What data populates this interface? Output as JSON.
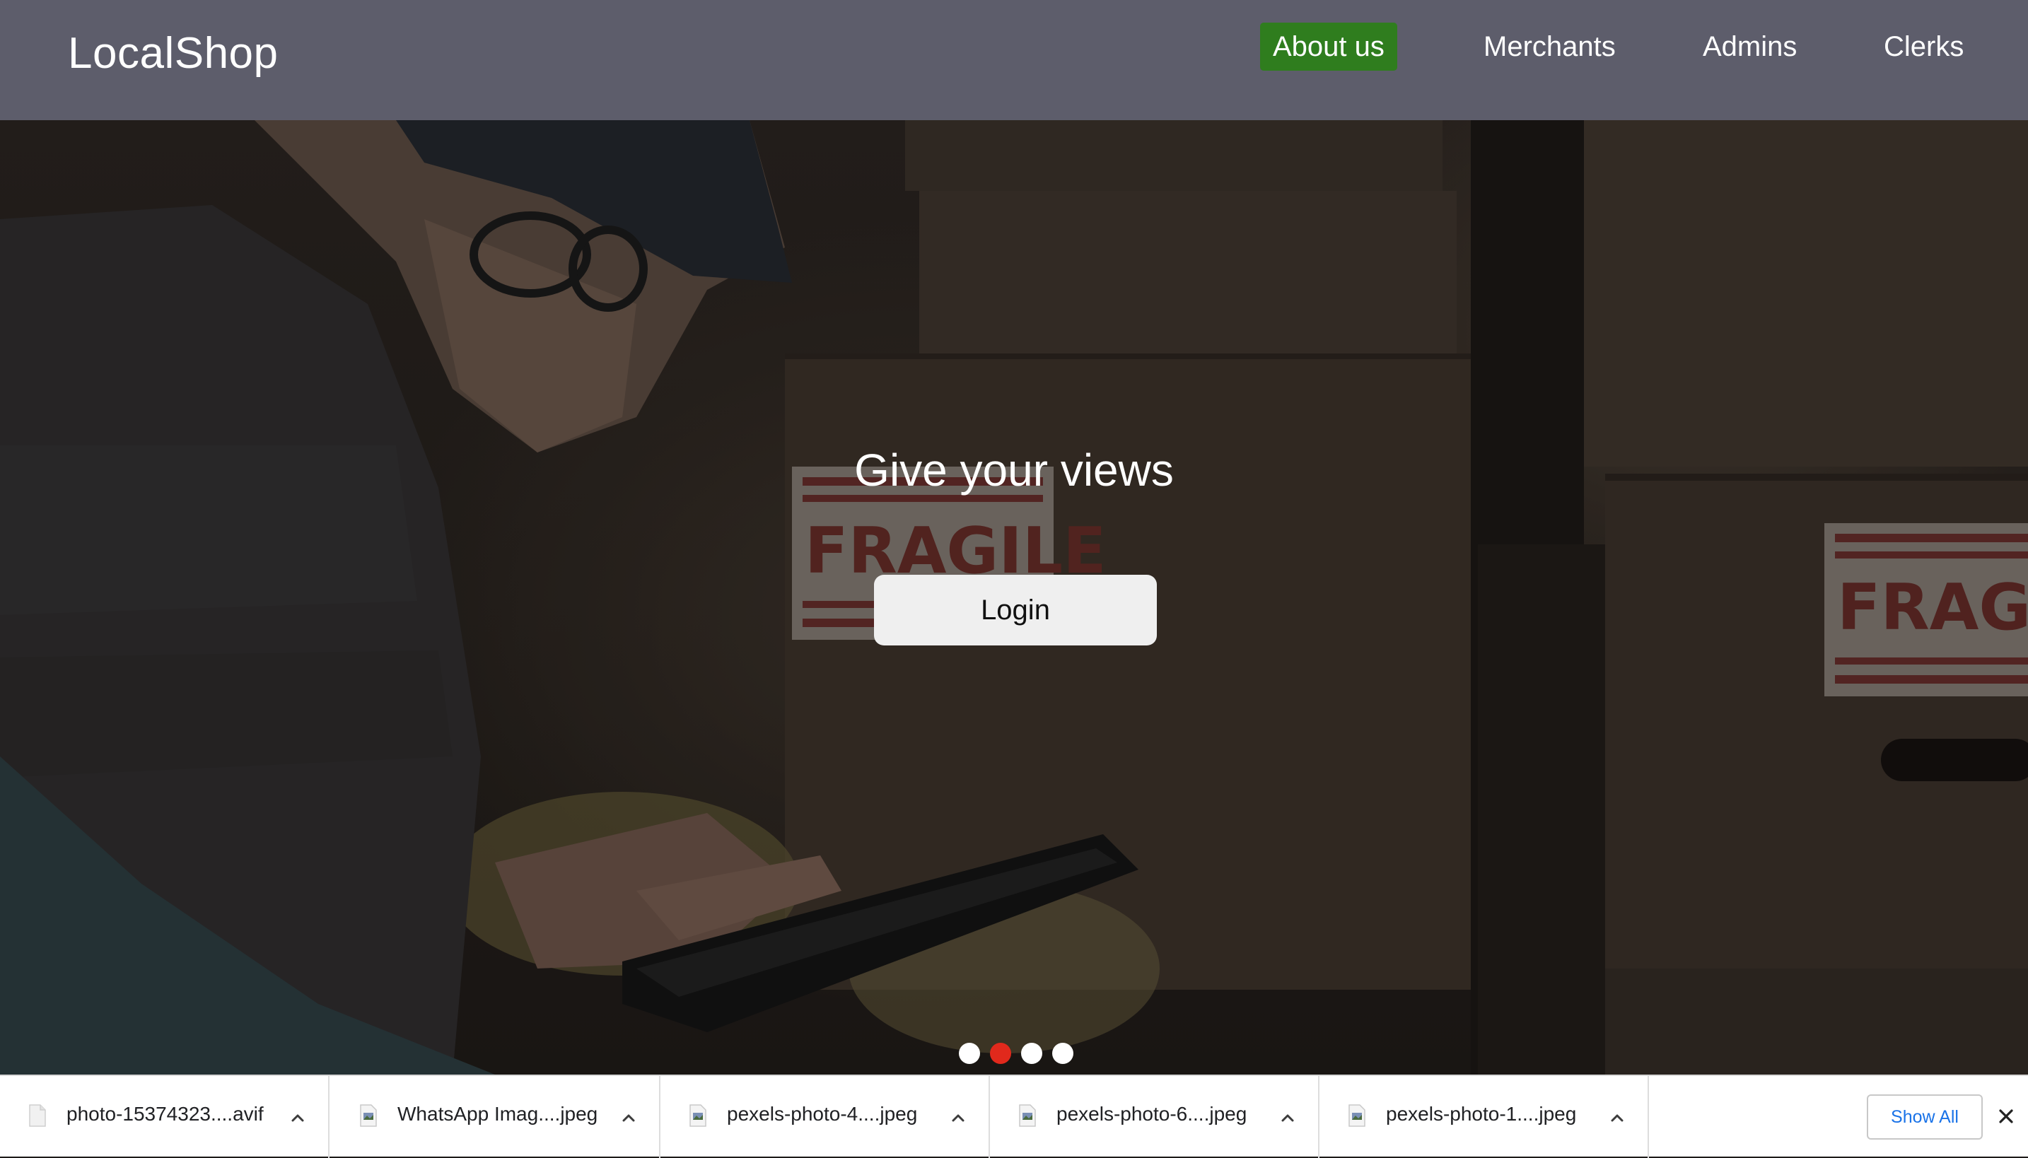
{
  "navbar": {
    "brand": "LocalShop",
    "items": [
      {
        "label": "About us",
        "active": true
      },
      {
        "label": "Merchants",
        "active": false
      },
      {
        "label": "Admins",
        "active": false
      },
      {
        "label": "Clerks",
        "active": false
      }
    ],
    "background": "#5d5d6b",
    "active_color": "#2f7d1e"
  },
  "hero": {
    "title": "Give your views",
    "login_label": "Login",
    "carousel": {
      "slide_count": 4,
      "active_index": 1,
      "active_color": "#e1291c",
      "inactive_color": "#ffffff"
    }
  },
  "downloads": {
    "items": [
      {
        "name": "photo-15374323....avif",
        "icon": "file-icon"
      },
      {
        "name": "WhatsApp Imag....jpeg",
        "icon": "image-file-icon"
      },
      {
        "name": "pexels-photo-4....jpeg",
        "icon": "image-file-icon"
      },
      {
        "name": "pexels-photo-6....jpeg",
        "icon": "image-file-icon"
      },
      {
        "name": "pexels-photo-1....jpeg",
        "icon": "image-file-icon"
      }
    ],
    "show_all_label": "Show All",
    "accent": "#1a73e8"
  }
}
